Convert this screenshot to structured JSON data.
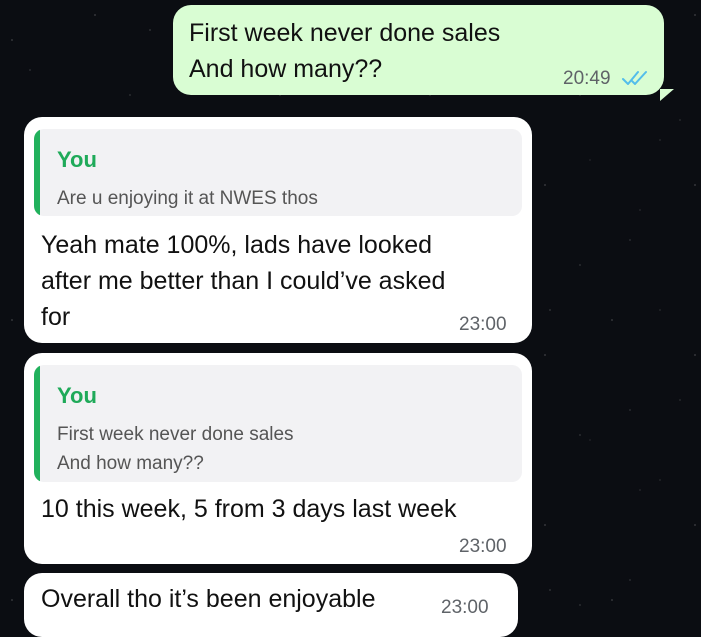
{
  "messages": [
    {
      "id": "m1",
      "direction": "outgoing",
      "lines": [
        "First week never done sales",
        "And how many??"
      ],
      "time": "20:49",
      "status": "read"
    },
    {
      "id": "m2",
      "direction": "incoming",
      "quote": {
        "author": "You",
        "lines": [
          "Are u enjoying it at NWES thos"
        ]
      },
      "lines": [
        "Yeah mate 100%, lads have looked",
        "after me better than I could’ve asked",
        "for"
      ],
      "time": "23:00"
    },
    {
      "id": "m3",
      "direction": "incoming",
      "quote": {
        "author": "You",
        "lines": [
          "First week never done sales",
          "And how many??"
        ]
      },
      "lines": [
        "10 this week, 5 from 3 days last week"
      ],
      "time": "23:00"
    },
    {
      "id": "m4",
      "direction": "incoming",
      "lines": [
        "Overall tho it’s been enjoyable"
      ],
      "time": "23:00"
    }
  ],
  "colors": {
    "outgoing_bubble": "#d9fdd3",
    "incoming_bubble": "#ffffff",
    "quote_accent": "#21b15c",
    "read_ticks": "#53bdeb",
    "background": "#0b0d12"
  },
  "icons": {
    "read_receipt": "double-check-icon"
  }
}
